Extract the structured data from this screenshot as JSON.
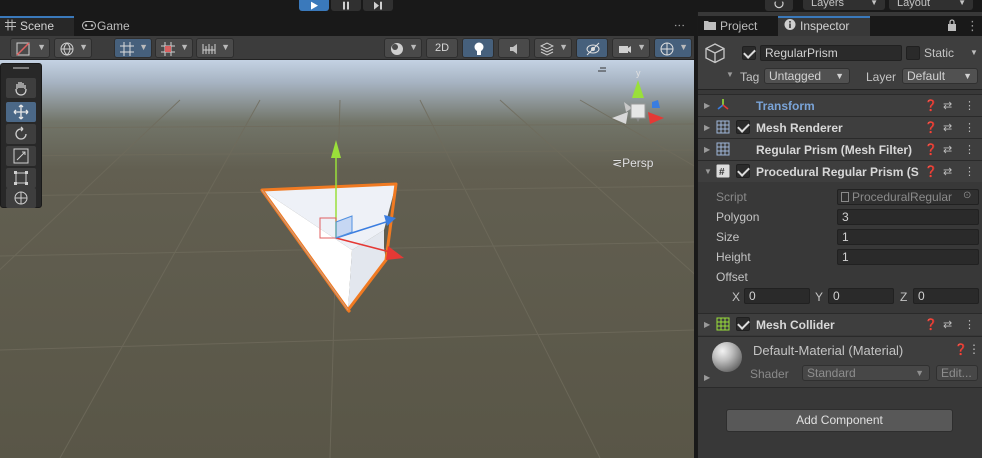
{
  "top_toolbar": {
    "play_icon": "play-icon",
    "pause_icon": "pause-icon",
    "step_icon": "step-icon",
    "history_icon": "history-icon",
    "layers_label": "Layers",
    "layout_label": "Layout"
  },
  "scene_panel": {
    "tabs": [
      {
        "label": "Scene",
        "icon": "grid-icon"
      },
      {
        "label": "Game",
        "icon": "gamepad-icon"
      }
    ],
    "toolbar": {
      "shading_icon": "shading-mode-icon",
      "global_icon": "global-icon",
      "grid_snap_icon": "grid-snap-icon",
      "snap_icon": "snap-increment-icon",
      "ruler_icon": "ruler-icon",
      "draw_mode_icon": "draw-mode-icon",
      "mode_2d_label": "2D",
      "lighting_icon": "lighting-icon",
      "audio_icon": "audio-icon",
      "effects_icon": "effects-icon",
      "hidden_icon": "scene-visibility-icon",
      "camera_icon": "camera-icon",
      "gizmos_icon": "gizmos-icon"
    },
    "tools": [
      "hand-tool-icon",
      "move-tool-icon",
      "rotate-tool-icon",
      "scale-tool-icon",
      "rect-tool-icon",
      "transform-tool-icon"
    ],
    "persp_label": "Persp",
    "colors": {
      "selection": "#f07a22",
      "y_axis": "#9ae03a",
      "x_axis": "#e53935",
      "z_axis": "#3a7de0"
    }
  },
  "inspector": {
    "tabs": [
      {
        "label": "Project",
        "icon": "folder-icon"
      },
      {
        "label": "Inspector",
        "icon": "info-icon"
      }
    ],
    "object": {
      "name": "RegularPrism",
      "static_label": "Static",
      "tag_label": "Tag",
      "tag_value": "Untagged",
      "layer_label": "Layer",
      "layer_value": "Default"
    },
    "components": [
      {
        "name": "Transform",
        "icon": "transform-icon"
      },
      {
        "name": "Mesh Renderer",
        "icon": "mesh-renderer-icon"
      },
      {
        "name": "Regular Prism (Mesh Filter)",
        "icon": "mesh-filter-icon"
      },
      {
        "name": "Procedural Regular Prism (S",
        "icon": "script-icon"
      },
      {
        "name": "Mesh Collider",
        "icon": "mesh-collider-icon"
      }
    ],
    "script_props": {
      "script_label": "Script",
      "script_value": "ProceduralRegular",
      "polygon_label": "Polygon",
      "polygon_value": "3",
      "size_label": "Size",
      "size_value": "1",
      "height_label": "Height",
      "height_value": "1",
      "offset_label": "Offset",
      "offset_x_label": "X",
      "offset_x_value": "0",
      "offset_y_label": "Y",
      "offset_y_value": "0",
      "offset_z_label": "Z",
      "offset_z_value": "0"
    },
    "material": {
      "name": "Default-Material (Material)",
      "shader_label": "Shader",
      "shader_value": "Standard",
      "edit_label": "Edit..."
    },
    "add_component_label": "Add Component"
  }
}
